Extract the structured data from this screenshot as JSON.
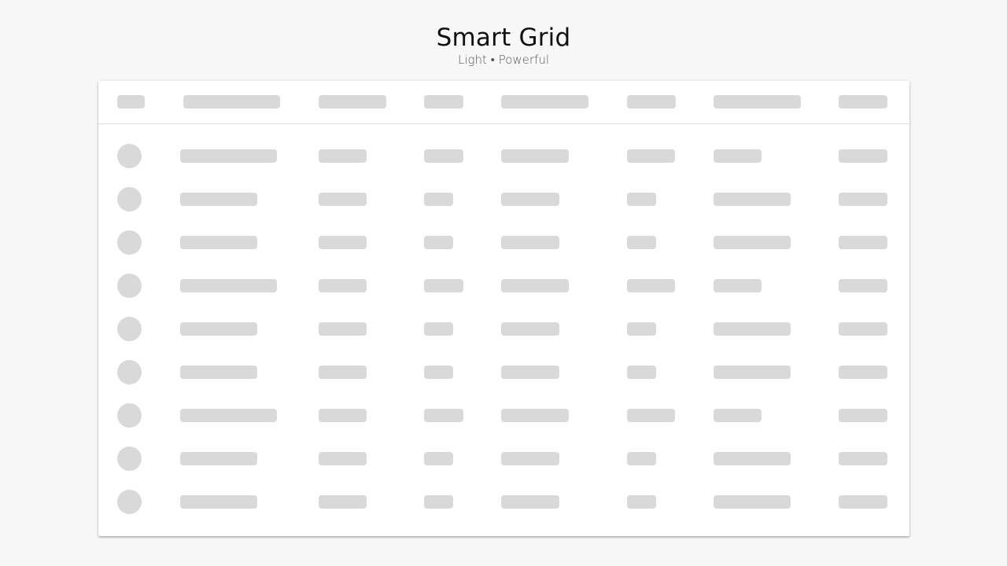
{
  "header": {
    "title": "Smart Grid",
    "subtitle": "Light • Powerful"
  },
  "grid": {
    "state": "loading-skeleton",
    "placeholder_color": "#d9d9d9",
    "row_count": 9,
    "column_count": 8
  }
}
